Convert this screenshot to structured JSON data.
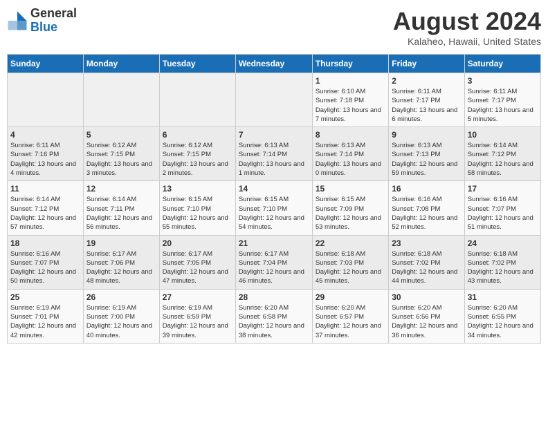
{
  "header": {
    "logo_line1": "General",
    "logo_line2": "Blue",
    "month_title": "August 2024",
    "location": "Kalaheo, Hawaii, United States"
  },
  "days_of_week": [
    "Sunday",
    "Monday",
    "Tuesday",
    "Wednesday",
    "Thursday",
    "Friday",
    "Saturday"
  ],
  "weeks": [
    [
      {
        "day": "",
        "sunrise": "",
        "sunset": "",
        "daylight": ""
      },
      {
        "day": "",
        "sunrise": "",
        "sunset": "",
        "daylight": ""
      },
      {
        "day": "",
        "sunrise": "",
        "sunset": "",
        "daylight": ""
      },
      {
        "day": "",
        "sunrise": "",
        "sunset": "",
        "daylight": ""
      },
      {
        "day": "1",
        "sunrise": "Sunrise: 6:10 AM",
        "sunset": "Sunset: 7:18 PM",
        "daylight": "Daylight: 13 hours and 7 minutes."
      },
      {
        "day": "2",
        "sunrise": "Sunrise: 6:11 AM",
        "sunset": "Sunset: 7:17 PM",
        "daylight": "Daylight: 13 hours and 6 minutes."
      },
      {
        "day": "3",
        "sunrise": "Sunrise: 6:11 AM",
        "sunset": "Sunset: 7:17 PM",
        "daylight": "Daylight: 13 hours and 5 minutes."
      }
    ],
    [
      {
        "day": "4",
        "sunrise": "Sunrise: 6:11 AM",
        "sunset": "Sunset: 7:16 PM",
        "daylight": "Daylight: 13 hours and 4 minutes."
      },
      {
        "day": "5",
        "sunrise": "Sunrise: 6:12 AM",
        "sunset": "Sunset: 7:15 PM",
        "daylight": "Daylight: 13 hours and 3 minutes."
      },
      {
        "day": "6",
        "sunrise": "Sunrise: 6:12 AM",
        "sunset": "Sunset: 7:15 PM",
        "daylight": "Daylight: 13 hours and 2 minutes."
      },
      {
        "day": "7",
        "sunrise": "Sunrise: 6:13 AM",
        "sunset": "Sunset: 7:14 PM",
        "daylight": "Daylight: 13 hours and 1 minute."
      },
      {
        "day": "8",
        "sunrise": "Sunrise: 6:13 AM",
        "sunset": "Sunset: 7:14 PM",
        "daylight": "Daylight: 13 hours and 0 minutes."
      },
      {
        "day": "9",
        "sunrise": "Sunrise: 6:13 AM",
        "sunset": "Sunset: 7:13 PM",
        "daylight": "Daylight: 12 hours and 59 minutes."
      },
      {
        "day": "10",
        "sunrise": "Sunrise: 6:14 AM",
        "sunset": "Sunset: 7:12 PM",
        "daylight": "Daylight: 12 hours and 58 minutes."
      }
    ],
    [
      {
        "day": "11",
        "sunrise": "Sunrise: 6:14 AM",
        "sunset": "Sunset: 7:12 PM",
        "daylight": "Daylight: 12 hours and 57 minutes."
      },
      {
        "day": "12",
        "sunrise": "Sunrise: 6:14 AM",
        "sunset": "Sunset: 7:11 PM",
        "daylight": "Daylight: 12 hours and 56 minutes."
      },
      {
        "day": "13",
        "sunrise": "Sunrise: 6:15 AM",
        "sunset": "Sunset: 7:10 PM",
        "daylight": "Daylight: 12 hours and 55 minutes."
      },
      {
        "day": "14",
        "sunrise": "Sunrise: 6:15 AM",
        "sunset": "Sunset: 7:10 PM",
        "daylight": "Daylight: 12 hours and 54 minutes."
      },
      {
        "day": "15",
        "sunrise": "Sunrise: 6:15 AM",
        "sunset": "Sunset: 7:09 PM",
        "daylight": "Daylight: 12 hours and 53 minutes."
      },
      {
        "day": "16",
        "sunrise": "Sunrise: 6:16 AM",
        "sunset": "Sunset: 7:08 PM",
        "daylight": "Daylight: 12 hours and 52 minutes."
      },
      {
        "day": "17",
        "sunrise": "Sunrise: 6:16 AM",
        "sunset": "Sunset: 7:07 PM",
        "daylight": "Daylight: 12 hours and 51 minutes."
      }
    ],
    [
      {
        "day": "18",
        "sunrise": "Sunrise: 6:16 AM",
        "sunset": "Sunset: 7:07 PM",
        "daylight": "Daylight: 12 hours and 50 minutes."
      },
      {
        "day": "19",
        "sunrise": "Sunrise: 6:17 AM",
        "sunset": "Sunset: 7:06 PM",
        "daylight": "Daylight: 12 hours and 48 minutes."
      },
      {
        "day": "20",
        "sunrise": "Sunrise: 6:17 AM",
        "sunset": "Sunset: 7:05 PM",
        "daylight": "Daylight: 12 hours and 47 minutes."
      },
      {
        "day": "21",
        "sunrise": "Sunrise: 6:17 AM",
        "sunset": "Sunset: 7:04 PM",
        "daylight": "Daylight: 12 hours and 46 minutes."
      },
      {
        "day": "22",
        "sunrise": "Sunrise: 6:18 AM",
        "sunset": "Sunset: 7:03 PM",
        "daylight": "Daylight: 12 hours and 45 minutes."
      },
      {
        "day": "23",
        "sunrise": "Sunrise: 6:18 AM",
        "sunset": "Sunset: 7:02 PM",
        "daylight": "Daylight: 12 hours and 44 minutes."
      },
      {
        "day": "24",
        "sunrise": "Sunrise: 6:18 AM",
        "sunset": "Sunset: 7:02 PM",
        "daylight": "Daylight: 12 hours and 43 minutes."
      }
    ],
    [
      {
        "day": "25",
        "sunrise": "Sunrise: 6:19 AM",
        "sunset": "Sunset: 7:01 PM",
        "daylight": "Daylight: 12 hours and 42 minutes."
      },
      {
        "day": "26",
        "sunrise": "Sunrise: 6:19 AM",
        "sunset": "Sunset: 7:00 PM",
        "daylight": "Daylight: 12 hours and 40 minutes."
      },
      {
        "day": "27",
        "sunrise": "Sunrise: 6:19 AM",
        "sunset": "Sunset: 6:59 PM",
        "daylight": "Daylight: 12 hours and 39 minutes."
      },
      {
        "day": "28",
        "sunrise": "Sunrise: 6:20 AM",
        "sunset": "Sunset: 6:58 PM",
        "daylight": "Daylight: 12 hours and 38 minutes."
      },
      {
        "day": "29",
        "sunrise": "Sunrise: 6:20 AM",
        "sunset": "Sunset: 6:57 PM",
        "daylight": "Daylight: 12 hours and 37 minutes."
      },
      {
        "day": "30",
        "sunrise": "Sunrise: 6:20 AM",
        "sunset": "Sunset: 6:56 PM",
        "daylight": "Daylight: 12 hours and 36 minutes."
      },
      {
        "day": "31",
        "sunrise": "Sunrise: 6:20 AM",
        "sunset": "Sunset: 6:55 PM",
        "daylight": "Daylight: 12 hours and 34 minutes."
      }
    ]
  ]
}
